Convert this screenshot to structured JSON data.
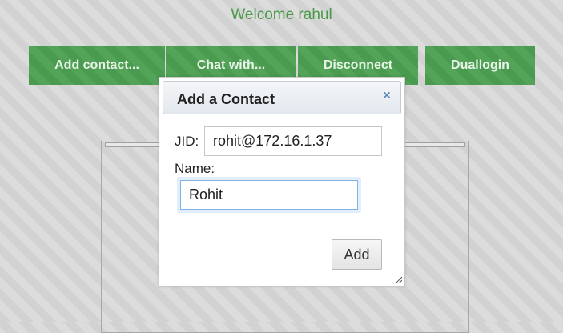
{
  "header": {
    "welcome_text": "Welcome rahul"
  },
  "toolbar": {
    "add_contact_label": "Add contact...",
    "chat_with_label": "Chat with...",
    "disconnect_label": "Disconnect",
    "duallogin_label": "Duallogin"
  },
  "dialog": {
    "title": "Add a Contact",
    "close_glyph": "×",
    "jid_label": "JID:",
    "jid_value": "rohit@172.16.1.37",
    "name_label": "Name:",
    "name_value": "Rohit",
    "add_button_label": "Add"
  },
  "colors": {
    "accent_green": "#4a9b4f",
    "welcome_text": "#4a9a4a",
    "close_icon": "#5a8ab8",
    "focus_border": "#7fb3e6"
  },
  "icons": {
    "close": "close-icon",
    "resize": "resize-handle-icon"
  }
}
